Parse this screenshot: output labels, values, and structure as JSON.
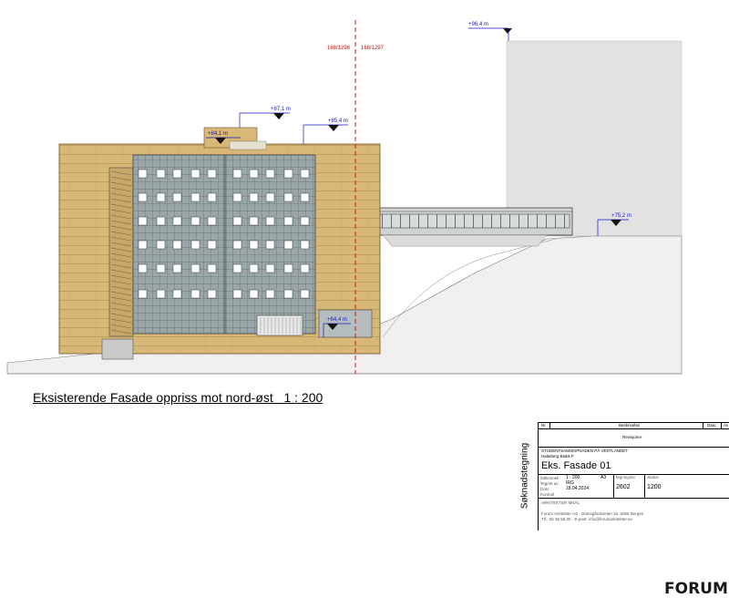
{
  "drawing": {
    "caption": "Eksisterende Fasade oppriss mot nord-øst   1 : 200",
    "gridlines": {
      "left": "168/1298",
      "right": "168/1297"
    },
    "elevations": [
      "+96,4 m",
      "+87,1 m",
      "+85,4 m",
      "+84,1 m",
      "+75,2 m",
      "+64,4 m"
    ]
  },
  "title_block": {
    "side_label": "Søknadstegning",
    "headers": {
      "nr": "Nr",
      "beskrivelse": "Beskrivelse",
      "dato": "Dato",
      "av": "Av"
    },
    "revisions_label": "Revisjoner",
    "client": "STUDENTSAMSKIPNADEN PÅ VESTLANDET",
    "project": "Hatleberg Blokk F",
    "drawing_title": "Eks. Fasade 01",
    "scale": "1 : 200",
    "paper": "A3",
    "drawn_by": "IRG",
    "date": "18.04.2024",
    "number": "2602",
    "sheet": "1200",
    "architect": "ARKITEKTER MNAL",
    "firm_line1": "Forum Arkitekter AS · Damsgårdsveien 16, 5058 Bergen",
    "firm_line2": "Tlf.: 55 36 55 00 · E-post: info@forumarkitekter.no",
    "logo": "FORUM",
    "labels": {
      "malestokk": "Målestokk",
      "tegnet": "Tegnet av",
      "dato": "Dato",
      "kontroll": "Kontroll",
      "tegningsnr": "Tegningsnr.",
      "status": "Status"
    }
  },
  "colors": {
    "wood": "#d8b876",
    "wood_line": "#8a6a34",
    "panel": "#9aa6a7",
    "panel_line": "#5a6768",
    "grey_box": "#e2e2e2",
    "ground": "#f0f0f0",
    "grid_red": "#d01010",
    "elev_blue": "#1515c8"
  }
}
